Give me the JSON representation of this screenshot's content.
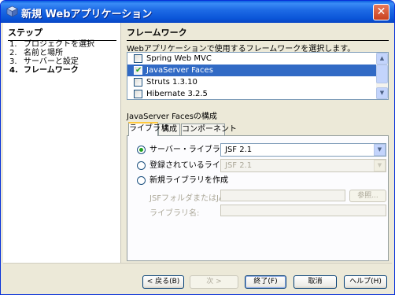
{
  "window": {
    "title": "新規 Webアプリケーション",
    "close_glyph": "✕"
  },
  "steps": {
    "header": "ステップ",
    "items": [
      {
        "num": "1.",
        "label": "プロジェクトを選択"
      },
      {
        "num": "2.",
        "label": "名前と場所"
      },
      {
        "num": "3.",
        "label": "サーバーと設定"
      },
      {
        "num": "4.",
        "label": "フレームワーク",
        "active": true
      }
    ]
  },
  "main": {
    "header": "フレームワーク",
    "description": "Webアプリケーションで使用するフレームワークを選択します。",
    "frameworks": [
      {
        "label": "Spring Web MVC",
        "checked": false,
        "selected": false
      },
      {
        "label": "JavaServer Faces",
        "checked": true,
        "selected": true
      },
      {
        "label": "Struts 1.3.10",
        "checked": false,
        "selected": false
      },
      {
        "label": "Hibernate 3.2.5",
        "checked": false,
        "selected": false
      }
    ],
    "config_title": "JavaServer Facesの構成",
    "tabs": [
      "ライブラリ",
      "構成",
      "コンポーネント"
    ],
    "library": {
      "server_library_label": "サーバー・ライブラリ:",
      "server_library_value": "JSF 2.1",
      "registered_library_label": "登録されているライブラリ:",
      "registered_library_value": "JSF 2.1",
      "new_library_label": "新規ライブラリを作成",
      "jar_label": "JSFフォルダまたはJAR:",
      "browse_label": "参照...",
      "library_name_label": "ライブラリ名:",
      "jar_value": "",
      "library_name_value": ""
    }
  },
  "buttons": {
    "back": "< 戻る(B)",
    "next": "次 >",
    "finish": "終了(F)",
    "cancel": "取消",
    "help": "ヘルプ(H)"
  },
  "colors": {
    "title_bar": "#0a55d8",
    "selection": "#316ac5",
    "active_tab_accent": "#ffc83c",
    "radio_check": "#21a121"
  }
}
